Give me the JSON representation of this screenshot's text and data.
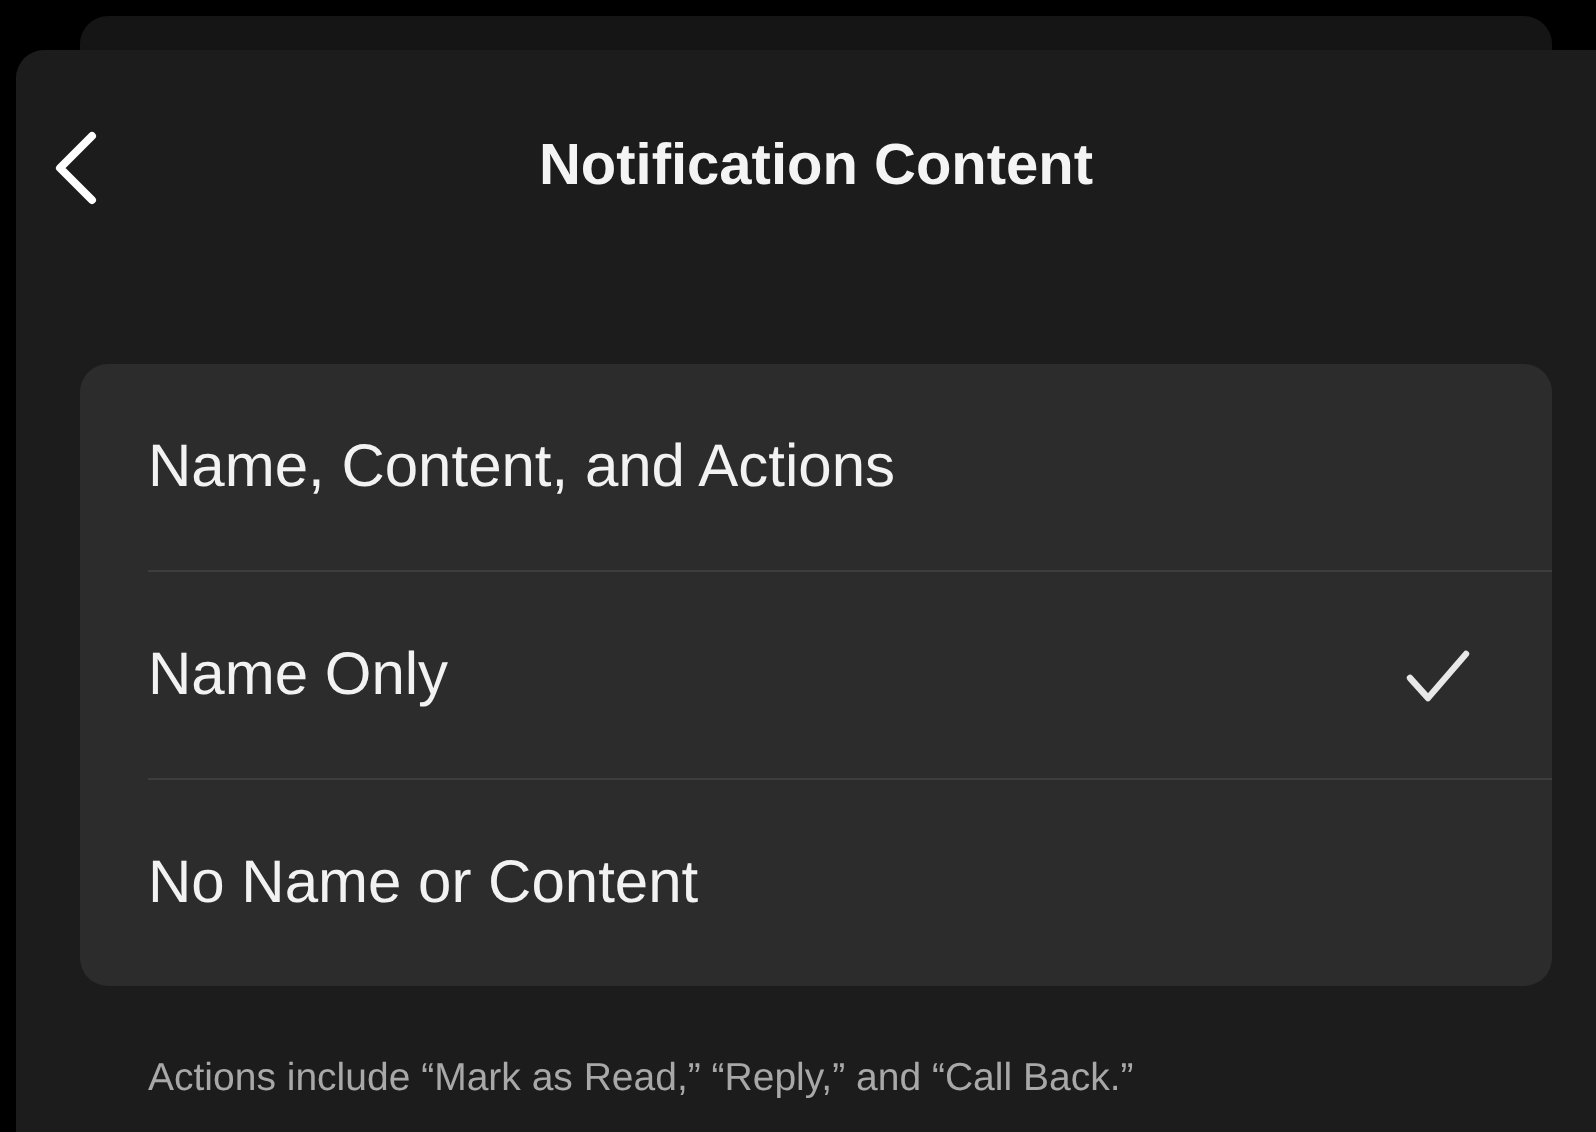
{
  "header": {
    "title": "Notification Content"
  },
  "options": [
    {
      "label": "Name, Content, and Actions",
      "selected": false
    },
    {
      "label": "Name Only",
      "selected": true
    },
    {
      "label": "No Name or Content",
      "selected": false
    }
  ],
  "footer": "Actions include “Mark as Read,” “Reply,” and “Call Back.”"
}
